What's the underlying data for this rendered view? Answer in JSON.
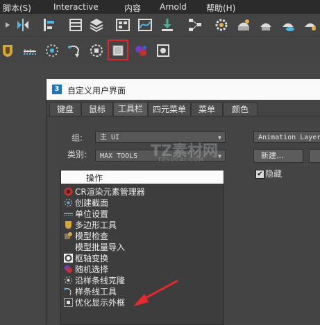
{
  "menu": [
    "脚本(S)",
    "Interactive",
    "内容",
    "Arnold",
    "帮助(H)"
  ],
  "toolbar_row1_icons": [
    "mirror-icon",
    "align-icon",
    "layer-explorer-icon",
    "layers-icon",
    "toggle-scene-explorer-icon",
    "curve-editor-icon",
    "import-icon",
    "schematic-view-icon",
    "render-setup-icon",
    "rendered-frame-window-icon",
    "render-production-icon",
    "render-cloud-icon"
  ],
  "toolbar_row2_icons": [
    "material-icon",
    "unit-setup-icon",
    "create-section-icon",
    "spline-tool-icon",
    "pivot-transform-icon",
    "display-bounding-box-icon",
    "random-select-icon",
    "object-paint-icon"
  ],
  "dialog": {
    "title": "自定义用户界面",
    "app_icon": "3",
    "tabs": [
      "键盘",
      "鼠标",
      "工具栏",
      "四元菜单",
      "菜单",
      "颜色"
    ],
    "active_tab": "工具栏",
    "group_label": "组:",
    "group_value": "主 UI",
    "category_label": "类别:",
    "category_value": "MAX TOOLS",
    "toolbar_select_value": "Animation Layer",
    "new_button": "新建...",
    "hide_label": "隐藏",
    "hide_checked": true,
    "actions_header": "操作",
    "actions": [
      {
        "label": "CR渲染元素管理器",
        "icon": "cr-element-manager-icon"
      },
      {
        "label": "创建截面",
        "icon": "create-section-icon"
      },
      {
        "label": "单位设置",
        "icon": "unit-setup-icon"
      },
      {
        "label": "多边形工具",
        "icon": "polygon-tool-icon"
      },
      {
        "label": "模型检查",
        "icon": "model-check-icon"
      },
      {
        "label": "模型批量导入",
        "icon": "batch-import-icon"
      },
      {
        "label": "枢轴变换",
        "icon": "pivot-transform-icon"
      },
      {
        "label": "随机选择",
        "icon": "random-select-icon"
      },
      {
        "label": "沿样条线克隆",
        "icon": "clone-along-spline-icon"
      },
      {
        "label": "样条线工具",
        "icon": "spline-tool-icon"
      },
      {
        "label": "优化显示外框",
        "icon": "display-bounding-box-icon"
      }
    ]
  },
  "watermark": {
    "line1": "TZ素材网",
    "line2": "TZSUCAI.COM"
  },
  "colors": {
    "highlight": "#e0262a",
    "arrow": "#e8282a",
    "panel": "#444444",
    "titlebar": "#fafafa"
  }
}
